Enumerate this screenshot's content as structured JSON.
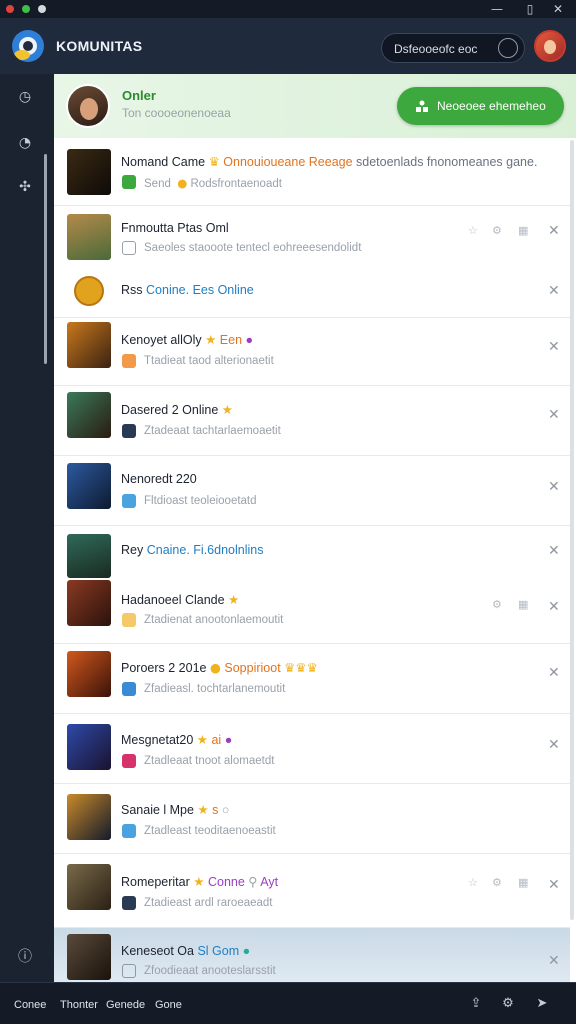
{
  "app": {
    "title": "KOMUNITAS",
    "search_placeholder": "Dsfeooeofc eoc",
    "accent_color": "#3da83d"
  },
  "banner": {
    "status": "Onler",
    "subtitle": "Ton coooeonenoeaa",
    "button_label": "Neoeoee ehemeheo"
  },
  "rows": [
    {
      "title": "Nomand Came",
      "highlight": "Onnouioueane Reeage",
      "extra": "sdetoenlads fnonomeanes gane.",
      "sub": "Send",
      "sub2": "Rodsfrontaenoadt"
    },
    {
      "title": "Fnmoutta Ptas Oml",
      "sub": "Saeoles staooote tentecl eohreeesendolidt"
    },
    {
      "title": "Rss",
      "highlight": "Conine. Ees Online"
    },
    {
      "title": "Kenoyet allOly",
      "highlight": "Een",
      "sub": "Ttadieat taod alterionaetit"
    },
    {
      "title": "Dasered 2 Online",
      "sub": "Ztadeaat tachtarlaemoaetit"
    },
    {
      "title": "Nenoredt 220",
      "sub": "Fltdioast teoleiooetatd"
    },
    {
      "title": "Rey",
      "highlight": "Cnaine. Fi.6dnolnlins"
    },
    {
      "title": "Hadanoeel Clande",
      "sub": "Ztadienat anootonlaemoutit"
    },
    {
      "title": "Poroers 2 201e",
      "highlight": "Soppirioot",
      "sub": "Zfadieasl. tochtarlanemoutit"
    },
    {
      "title": "Mesgnetat20",
      "highlight": "ai",
      "sub": "Ztadleaat tnoot alomaetdt"
    },
    {
      "title": "Sanaie l Mpe",
      "highlight": "s",
      "sub": "Ztadleast teoditaenoeastit"
    },
    {
      "title": "Romeperitar",
      "highlight": "Conne",
      "extra": "Ayt",
      "sub": "Ztadieast ardl raroeaeadt"
    },
    {
      "title": "Keneseot Oa",
      "highlight": "Sl Gom",
      "sub": "Zfoodieaat anooteslarsstit"
    }
  ],
  "bottom": {
    "links": [
      "Conee",
      "Thonter",
      "Genede",
      "Gone"
    ]
  }
}
